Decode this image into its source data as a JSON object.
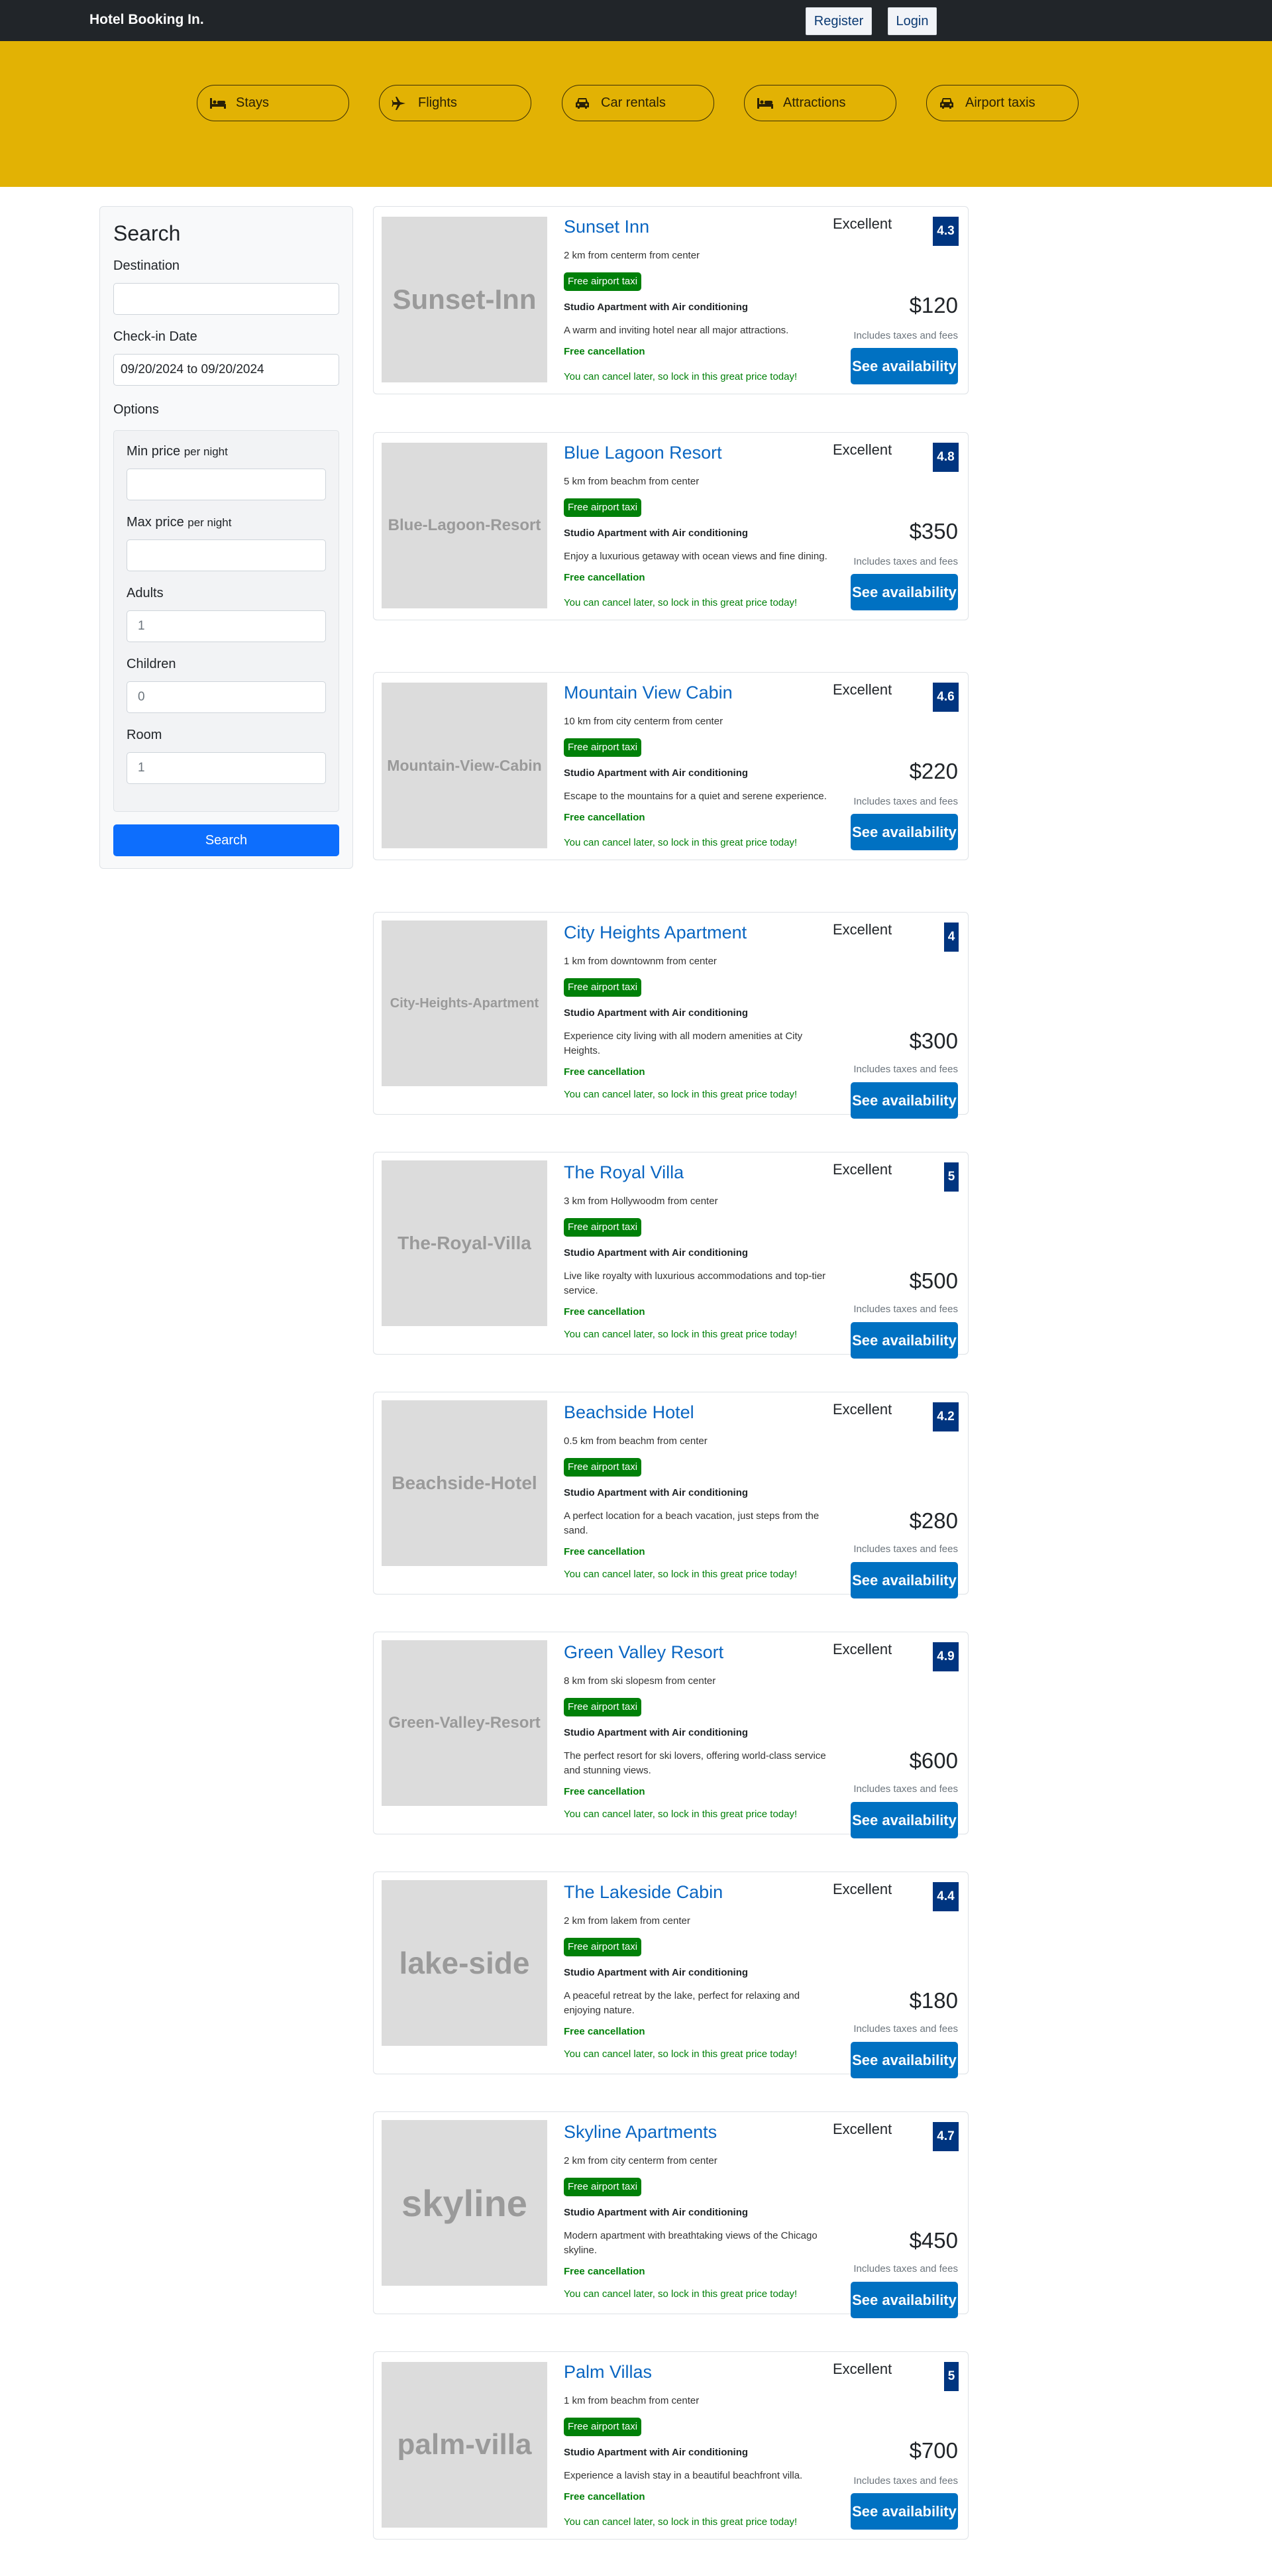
{
  "navbar": {
    "brand": "Hotel Booking In.",
    "register_label": "Register",
    "login_label": "Login"
  },
  "header": {
    "tabs": [
      {
        "label": "Stays",
        "icon": "bed-icon"
      },
      {
        "label": "Flights",
        "icon": "plane-icon"
      },
      {
        "label": "Car rentals",
        "icon": "car-icon"
      },
      {
        "label": "Attractions",
        "icon": "bed-icon"
      },
      {
        "label": "Airport taxis",
        "icon": "taxi-icon"
      }
    ]
  },
  "search": {
    "title": "Search",
    "destination_label": "Destination",
    "destination_value": "",
    "checkin_label": "Check-in Date",
    "checkin_value": "09/20/2024 to 09/20/2024",
    "options_label": "Options",
    "min_price_label": "Min price",
    "per_night": "per night",
    "min_price_value": "",
    "max_price_label": "Max price",
    "max_price_value": "",
    "adults_label": "Adults",
    "adults_value": "1",
    "children_label": "Children",
    "children_value": "0",
    "room_label": "Room",
    "room_value": "1",
    "button_label": "Search"
  },
  "common": {
    "taxi_badge": "Free airport taxi",
    "room_type": "Studio Apartment with Air conditioning",
    "free_cancellation": "Free cancellation",
    "cancel_subtitle": "You can cancel later, so lock in this great price today!",
    "rating_text": "Excellent",
    "taxes": "Includes taxes and fees",
    "availability_button": "See availability"
  },
  "hotels": [
    {
      "name": "Sunset Inn",
      "thumb_text": "Sunset-Inn",
      "distance": "2 km from centerm from center",
      "description": "A warm and inviting hotel near all major attractions.",
      "score": "4.3",
      "price": "$120"
    },
    {
      "name": "Blue Lagoon Resort",
      "thumb_text": "Blue-Lagoon-Resort",
      "distance": "5 km from beachm from center",
      "description": "Enjoy a luxurious getaway with ocean views and fine dining.",
      "score": "4.8",
      "price": "$350"
    },
    {
      "name": "Mountain View Cabin",
      "thumb_text": "Mountain-View-Cabin",
      "distance": "10 km from city centerm from center",
      "description": "Escape to the mountains for a quiet and serene experience.",
      "score": "4.6",
      "price": "$220"
    },
    {
      "name": "City Heights Apartment",
      "thumb_text": "City-Heights-Apartment",
      "distance": "1 km from downtownm from center",
      "description": "Experience city living with all modern amenities at City Heights.",
      "score": "4",
      "price": "$300"
    },
    {
      "name": "The Royal Villa",
      "thumb_text": "The-Royal-Villa",
      "distance": "3 km from Hollywoodm from center",
      "description": "Live like royalty with luxurious accommodations and top-tier service.",
      "score": "5",
      "price": "$500"
    },
    {
      "name": "Beachside Hotel",
      "thumb_text": "Beachside-Hotel",
      "distance": "0.5 km from beachm from center",
      "description": "A perfect location for a beach vacation, just steps from the sand.",
      "score": "4.2",
      "price": "$280"
    },
    {
      "name": "Green Valley Resort",
      "thumb_text": "Green-Valley-Resort",
      "distance": "8 km from ski slopesm from center",
      "description": "The perfect resort for ski lovers, offering world-class service and stunning views.",
      "score": "4.9",
      "price": "$600"
    },
    {
      "name": "The Lakeside Cabin",
      "thumb_text": "lake-side",
      "distance": "2 km from lakem from center",
      "description": "A peaceful retreat by the lake, perfect for relaxing and enjoying nature.",
      "score": "4.4",
      "price": "$180"
    },
    {
      "name": "Skyline Apartments",
      "thumb_text": "skyline",
      "distance": "2 km from city centerm from center",
      "description": "Modern apartment with breathtaking views of the Chicago skyline.",
      "score": "4.7",
      "price": "$450"
    },
    {
      "name": "Palm Villas",
      "thumb_text": "palm-villa",
      "distance": "1 km from beachm from center",
      "description": "Experience a lavish stay in a beautiful beachfront villa.",
      "score": "5",
      "price": "$700"
    }
  ]
}
